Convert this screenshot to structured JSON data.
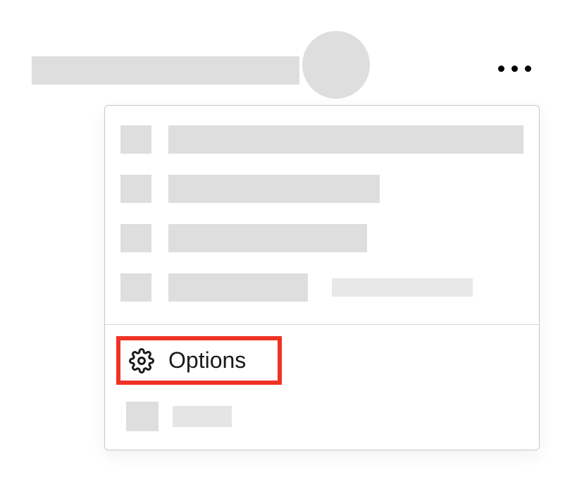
{
  "menu": {
    "options_label": "Options"
  }
}
